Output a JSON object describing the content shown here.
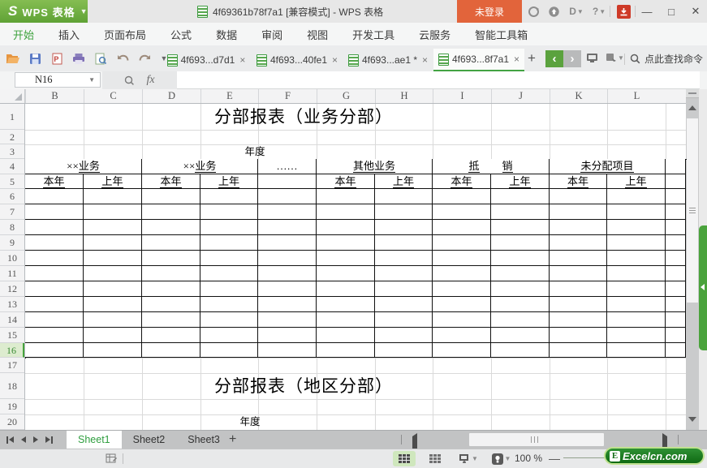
{
  "window": {
    "logo_letter": "S",
    "app_name": "WPS 表格",
    "doc_title": "4f69361b78f7a1 [兼容模式] - WPS 表格",
    "login_label": "未登录",
    "minimize_glyph": "—",
    "maximize_glyph": "□",
    "close_glyph": "✕"
  },
  "menu": {
    "tabs": [
      "开始",
      "插入",
      "页面布局",
      "公式",
      "数据",
      "审阅",
      "视图",
      "开发工具",
      "云服务",
      "智能工具箱"
    ],
    "active_index": 0
  },
  "toolbar": {
    "doc_tabs": [
      {
        "label": "4f693...d7d1",
        "close": "×",
        "active": false
      },
      {
        "label": "4f693...40fe1",
        "close": "×",
        "active": false
      },
      {
        "label": "4f693...ae1 *",
        "close": "×",
        "active": false
      },
      {
        "label": "4f693...8f7a1",
        "close": "×",
        "active": true
      }
    ],
    "new_tab_glyph": "+",
    "nav_back_glyph": "‹",
    "nav_forward_glyph": "›",
    "search_label": "点此查找命令"
  },
  "formula_bar": {
    "name_box_value": "N16",
    "fx_label": "fx"
  },
  "grid": {
    "column_headers": [
      "B",
      "C",
      "D",
      "E",
      "F",
      "G",
      "H",
      "I",
      "J",
      "K",
      "L"
    ],
    "row_headers": [
      "1",
      "2",
      "3",
      "4",
      "5",
      "6",
      "7",
      "8",
      "9",
      "10",
      "11",
      "12",
      "13",
      "14",
      "15",
      "16",
      "17",
      "18",
      "19",
      "20"
    ],
    "selected_row": "16"
  },
  "table": {
    "title_business": "分部报表（业务分部）",
    "year_label": "年度",
    "title_region": "分部报表（地区分部）",
    "year_label2": "年度",
    "header_groups": [
      {
        "prefix": "××",
        "text": "业务",
        "span": 2
      },
      {
        "prefix": "××",
        "text": "业务",
        "span": 2
      },
      {
        "prefix": "……",
        "text": "",
        "span": 1
      },
      {
        "prefix": "",
        "text": "其他业务",
        "span": 2
      },
      {
        "prefix": "",
        "text": "抵",
        "text2": "销",
        "span": 2
      },
      {
        "prefix": "",
        "text": "未分配项目",
        "span": 2
      }
    ],
    "sub_headers": [
      "本年",
      "上年",
      "本年",
      "上年",
      "",
      "本年",
      "上年",
      "本年",
      "上年",
      "本年",
      "上年"
    ],
    "body_row_count": 11
  },
  "sheet_bar": {
    "tabs": [
      "Sheet1",
      "Sheet2",
      "Sheet3"
    ],
    "active": "Sheet1",
    "add_glyph": "+"
  },
  "status_bar": {
    "zoom_value": "100 %",
    "zoom_minus_glyph": "—",
    "brand_e": "E",
    "brand_name": "Excelcn.com"
  }
}
